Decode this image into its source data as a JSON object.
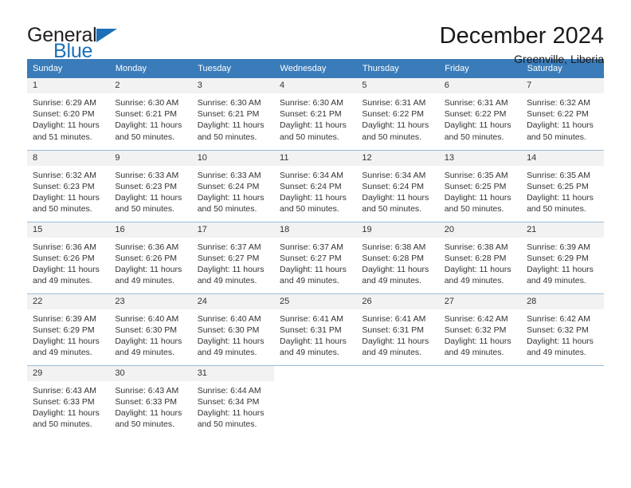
{
  "brand": {
    "name_part1": "General",
    "name_part2": "Blue",
    "primary_color": "#1c70b8",
    "text_color": "#231f20"
  },
  "header": {
    "title": "December 2024",
    "subtitle": "Greenville, Liberia"
  },
  "theme": {
    "header_row_bg": "#3a7cb9",
    "header_row_text": "#ffffff",
    "daynum_bg": "#f2f2f2",
    "row_divider": "#9bbcd8"
  },
  "weekdays": [
    "Sunday",
    "Monday",
    "Tuesday",
    "Wednesday",
    "Thursday",
    "Friday",
    "Saturday"
  ],
  "weeks": [
    [
      {
        "day": "1",
        "sunrise": "Sunrise: 6:29 AM",
        "sunset": "Sunset: 6:20 PM",
        "daylight": "Daylight: 11 hours and 51 minutes."
      },
      {
        "day": "2",
        "sunrise": "Sunrise: 6:30 AM",
        "sunset": "Sunset: 6:21 PM",
        "daylight": "Daylight: 11 hours and 50 minutes."
      },
      {
        "day": "3",
        "sunrise": "Sunrise: 6:30 AM",
        "sunset": "Sunset: 6:21 PM",
        "daylight": "Daylight: 11 hours and 50 minutes."
      },
      {
        "day": "4",
        "sunrise": "Sunrise: 6:30 AM",
        "sunset": "Sunset: 6:21 PM",
        "daylight": "Daylight: 11 hours and 50 minutes."
      },
      {
        "day": "5",
        "sunrise": "Sunrise: 6:31 AM",
        "sunset": "Sunset: 6:22 PM",
        "daylight": "Daylight: 11 hours and 50 minutes."
      },
      {
        "day": "6",
        "sunrise": "Sunrise: 6:31 AM",
        "sunset": "Sunset: 6:22 PM",
        "daylight": "Daylight: 11 hours and 50 minutes."
      },
      {
        "day": "7",
        "sunrise": "Sunrise: 6:32 AM",
        "sunset": "Sunset: 6:22 PM",
        "daylight": "Daylight: 11 hours and 50 minutes."
      }
    ],
    [
      {
        "day": "8",
        "sunrise": "Sunrise: 6:32 AM",
        "sunset": "Sunset: 6:23 PM",
        "daylight": "Daylight: 11 hours and 50 minutes."
      },
      {
        "day": "9",
        "sunrise": "Sunrise: 6:33 AM",
        "sunset": "Sunset: 6:23 PM",
        "daylight": "Daylight: 11 hours and 50 minutes."
      },
      {
        "day": "10",
        "sunrise": "Sunrise: 6:33 AM",
        "sunset": "Sunset: 6:24 PM",
        "daylight": "Daylight: 11 hours and 50 minutes."
      },
      {
        "day": "11",
        "sunrise": "Sunrise: 6:34 AM",
        "sunset": "Sunset: 6:24 PM",
        "daylight": "Daylight: 11 hours and 50 minutes."
      },
      {
        "day": "12",
        "sunrise": "Sunrise: 6:34 AM",
        "sunset": "Sunset: 6:24 PM",
        "daylight": "Daylight: 11 hours and 50 minutes."
      },
      {
        "day": "13",
        "sunrise": "Sunrise: 6:35 AM",
        "sunset": "Sunset: 6:25 PM",
        "daylight": "Daylight: 11 hours and 50 minutes."
      },
      {
        "day": "14",
        "sunrise": "Sunrise: 6:35 AM",
        "sunset": "Sunset: 6:25 PM",
        "daylight": "Daylight: 11 hours and 50 minutes."
      }
    ],
    [
      {
        "day": "15",
        "sunrise": "Sunrise: 6:36 AM",
        "sunset": "Sunset: 6:26 PM",
        "daylight": "Daylight: 11 hours and 49 minutes."
      },
      {
        "day": "16",
        "sunrise": "Sunrise: 6:36 AM",
        "sunset": "Sunset: 6:26 PM",
        "daylight": "Daylight: 11 hours and 49 minutes."
      },
      {
        "day": "17",
        "sunrise": "Sunrise: 6:37 AM",
        "sunset": "Sunset: 6:27 PM",
        "daylight": "Daylight: 11 hours and 49 minutes."
      },
      {
        "day": "18",
        "sunrise": "Sunrise: 6:37 AM",
        "sunset": "Sunset: 6:27 PM",
        "daylight": "Daylight: 11 hours and 49 minutes."
      },
      {
        "day": "19",
        "sunrise": "Sunrise: 6:38 AM",
        "sunset": "Sunset: 6:28 PM",
        "daylight": "Daylight: 11 hours and 49 minutes."
      },
      {
        "day": "20",
        "sunrise": "Sunrise: 6:38 AM",
        "sunset": "Sunset: 6:28 PM",
        "daylight": "Daylight: 11 hours and 49 minutes."
      },
      {
        "day": "21",
        "sunrise": "Sunrise: 6:39 AM",
        "sunset": "Sunset: 6:29 PM",
        "daylight": "Daylight: 11 hours and 49 minutes."
      }
    ],
    [
      {
        "day": "22",
        "sunrise": "Sunrise: 6:39 AM",
        "sunset": "Sunset: 6:29 PM",
        "daylight": "Daylight: 11 hours and 49 minutes."
      },
      {
        "day": "23",
        "sunrise": "Sunrise: 6:40 AM",
        "sunset": "Sunset: 6:30 PM",
        "daylight": "Daylight: 11 hours and 49 minutes."
      },
      {
        "day": "24",
        "sunrise": "Sunrise: 6:40 AM",
        "sunset": "Sunset: 6:30 PM",
        "daylight": "Daylight: 11 hours and 49 minutes."
      },
      {
        "day": "25",
        "sunrise": "Sunrise: 6:41 AM",
        "sunset": "Sunset: 6:31 PM",
        "daylight": "Daylight: 11 hours and 49 minutes."
      },
      {
        "day": "26",
        "sunrise": "Sunrise: 6:41 AM",
        "sunset": "Sunset: 6:31 PM",
        "daylight": "Daylight: 11 hours and 49 minutes."
      },
      {
        "day": "27",
        "sunrise": "Sunrise: 6:42 AM",
        "sunset": "Sunset: 6:32 PM",
        "daylight": "Daylight: 11 hours and 49 minutes."
      },
      {
        "day": "28",
        "sunrise": "Sunrise: 6:42 AM",
        "sunset": "Sunset: 6:32 PM",
        "daylight": "Daylight: 11 hours and 49 minutes."
      }
    ],
    [
      {
        "day": "29",
        "sunrise": "Sunrise: 6:43 AM",
        "sunset": "Sunset: 6:33 PM",
        "daylight": "Daylight: 11 hours and 50 minutes."
      },
      {
        "day": "30",
        "sunrise": "Sunrise: 6:43 AM",
        "sunset": "Sunset: 6:33 PM",
        "daylight": "Daylight: 11 hours and 50 minutes."
      },
      {
        "day": "31",
        "sunrise": "Sunrise: 6:44 AM",
        "sunset": "Sunset: 6:34 PM",
        "daylight": "Daylight: 11 hours and 50 minutes."
      },
      {
        "day": "",
        "sunrise": "",
        "sunset": "",
        "daylight": ""
      },
      {
        "day": "",
        "sunrise": "",
        "sunset": "",
        "daylight": ""
      },
      {
        "day": "",
        "sunrise": "",
        "sunset": "",
        "daylight": ""
      },
      {
        "day": "",
        "sunrise": "",
        "sunset": "",
        "daylight": ""
      }
    ]
  ]
}
